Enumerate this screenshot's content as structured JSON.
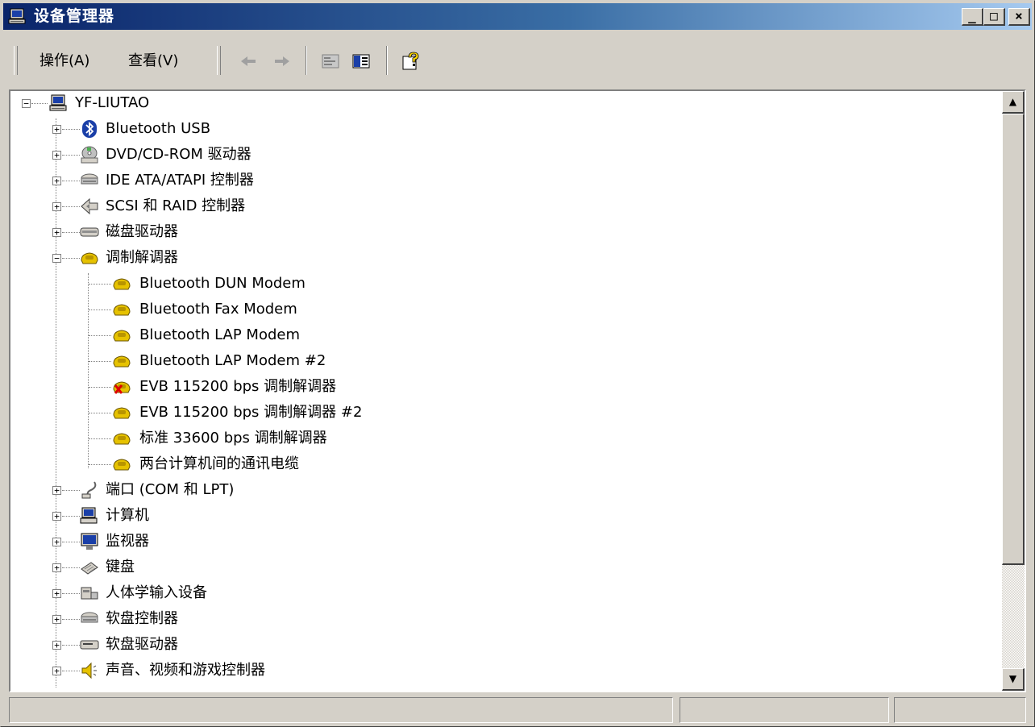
{
  "window": {
    "title": "设备管理器",
    "controls": {
      "minimize": "_",
      "maximize": "□",
      "close": "×"
    }
  },
  "menu": {
    "action": "操作(A)",
    "view": "查看(V)"
  },
  "toolbar_icons": [
    "back-arrow-icon",
    "forward-arrow-icon",
    "properties-icon",
    "show-hide-tree-icon",
    "help-icon"
  ],
  "tree": {
    "root": "YF-LIUTAO",
    "categories": [
      {
        "label": "Bluetooth USB",
        "icon": "bluetooth-icon",
        "expanded": false
      },
      {
        "label": "DVD/CD-ROM 驱动器",
        "icon": "dvd-drive-icon",
        "expanded": false
      },
      {
        "label": "IDE ATA/ATAPI 控制器",
        "icon": "ide-controller-icon",
        "expanded": false
      },
      {
        "label": "SCSI 和 RAID 控制器",
        "icon": "scsi-controller-icon",
        "expanded": false
      },
      {
        "label": "磁盘驱动器",
        "icon": "disk-drive-icon",
        "expanded": false
      },
      {
        "label": "调制解调器",
        "icon": "modem-icon",
        "expanded": true,
        "children": [
          {
            "label": "Bluetooth DUN Modem",
            "icon": "modem-icon",
            "disabled": false
          },
          {
            "label": "Bluetooth Fax Modem",
            "icon": "modem-icon",
            "disabled": false
          },
          {
            "label": "Bluetooth LAP Modem",
            "icon": "modem-icon",
            "disabled": false
          },
          {
            "label": "Bluetooth LAP Modem #2",
            "icon": "modem-icon",
            "disabled": false
          },
          {
            "label": "EVB 115200 bps 调制解调器",
            "icon": "modem-icon",
            "disabled": true
          },
          {
            "label": "EVB 115200 bps 调制解调器 #2",
            "icon": "modem-icon",
            "disabled": false
          },
          {
            "label": "标准 33600 bps 调制解调器",
            "icon": "modem-icon",
            "disabled": false
          },
          {
            "label": "两台计算机间的通讯电缆",
            "icon": "modem-icon",
            "disabled": false
          }
        ]
      },
      {
        "label": "端口 (COM 和 LPT)",
        "icon": "port-icon",
        "expanded": false
      },
      {
        "label": "计算机",
        "icon": "computer-icon",
        "expanded": false
      },
      {
        "label": "监视器",
        "icon": "monitor-icon",
        "expanded": false
      },
      {
        "label": "键盘",
        "icon": "keyboard-icon",
        "expanded": false
      },
      {
        "label": "人体学输入设备",
        "icon": "hid-icon",
        "expanded": false
      },
      {
        "label": "软盘控制器",
        "icon": "floppy-controller-icon",
        "expanded": false
      },
      {
        "label": "软盘驱动器",
        "icon": "floppy-drive-icon",
        "expanded": false
      },
      {
        "label": "声音、视频和游戏控制器",
        "icon": "speaker-icon",
        "expanded": false
      }
    ]
  },
  "status_bar": {
    "panes": [
      "",
      "",
      ""
    ]
  }
}
